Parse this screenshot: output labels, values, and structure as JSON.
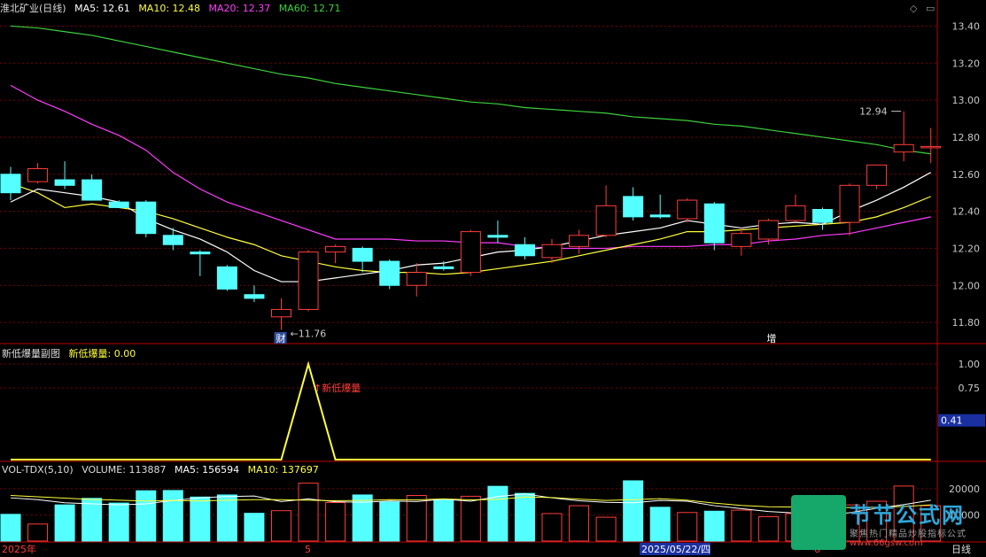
{
  "header": {
    "title": "淮北矿业(日线)",
    "ma5": "MA5: 12.61",
    "ma10": "MA10: 12.48",
    "ma20": "MA20: 12.37",
    "ma60": "MA60: 12.71"
  },
  "colors": {
    "up": "#ff3c3c",
    "down": "#54ffff",
    "ma5": "#ffffff",
    "ma10": "#ffff3c",
    "ma20": "#ff3cff",
    "ma60": "#3cd23c",
    "grid": "#7a0000",
    "axis": "#c00000"
  },
  "price_axis": {
    "ticks": [
      "13.40",
      "13.20",
      "13.00",
      "12.80",
      "12.60",
      "12.40",
      "12.20",
      "12.00",
      "11.80"
    ]
  },
  "annotations": {
    "high_label": "12.94",
    "low_label": "11.76",
    "cai_tag": "财",
    "zeng_tag": "增"
  },
  "indicator": {
    "title": "新低爆量副图",
    "value_label": "新低爆量: 0.00",
    "signal_label": "新低爆量",
    "ticks": [
      "1.00",
      "0.75",
      "0.41"
    ],
    "current": "0.41",
    "values": [
      0,
      0,
      0,
      0,
      0,
      0,
      0,
      0,
      0,
      0,
      0,
      1,
      0,
      0,
      0,
      0,
      0,
      0,
      0,
      0,
      0,
      0,
      0,
      0,
      0,
      0,
      0,
      0,
      0,
      0,
      0,
      0,
      0,
      0,
      0
    ]
  },
  "volume": {
    "title": "VOL-TDX(5,10)",
    "volume": "VOLUME: 113887",
    "ma5": "MA5: 156594",
    "ma10": "MA10: 137697",
    "ticks": [
      "20000",
      "10000"
    ],
    "x_labels": [
      "2025年",
      "5",
      "2025/05/22/四",
      "6",
      "日线"
    ]
  },
  "watermark": {
    "brand": "节节公式网",
    "slogan": "聚焦热门精品炒股指标公式",
    "url": "www.66gsw.com"
  },
  "chart_data": {
    "type": "candlestick",
    "ylim": [
      11.7,
      13.45
    ],
    "candles": [
      {
        "o": 12.6,
        "c": 12.5,
        "h": 12.64,
        "l": 12.46
      },
      {
        "o": 12.56,
        "c": 12.63,
        "h": 12.66,
        "l": 12.55
      },
      {
        "o": 12.57,
        "c": 12.54,
        "h": 12.67,
        "l": 12.52
      },
      {
        "o": 12.57,
        "c": 12.46,
        "h": 12.6,
        "l": 12.46
      },
      {
        "o": 12.45,
        "c": 12.42,
        "h": 12.46,
        "l": 12.42
      },
      {
        "o": 12.45,
        "c": 12.28,
        "h": 12.46,
        "l": 12.26
      },
      {
        "o": 12.27,
        "c": 12.22,
        "h": 12.31,
        "l": 12.19
      },
      {
        "o": 12.18,
        "c": 12.17,
        "h": 12.19,
        "l": 12.05
      },
      {
        "o": 12.1,
        "c": 11.98,
        "h": 12.11,
        "l": 11.97
      },
      {
        "o": 11.95,
        "c": 11.93,
        "h": 12.0,
        "l": 11.91
      },
      {
        "o": 11.83,
        "c": 11.87,
        "h": 11.93,
        "l": 11.76
      },
      {
        "o": 11.87,
        "c": 12.18,
        "h": 12.19,
        "l": 11.86
      },
      {
        "o": 12.18,
        "c": 12.21,
        "h": 12.22,
        "l": 12.12
      },
      {
        "o": 12.2,
        "c": 12.13,
        "h": 12.21,
        "l": 12.07
      },
      {
        "o": 12.13,
        "c": 12.0,
        "h": 12.14,
        "l": 11.98
      },
      {
        "o": 12.0,
        "c": 12.07,
        "h": 12.12,
        "l": 11.94
      },
      {
        "o": 12.1,
        "c": 12.09,
        "h": 12.13,
        "l": 12.08
      },
      {
        "o": 12.07,
        "c": 12.29,
        "h": 12.3,
        "l": 12.05
      },
      {
        "o": 12.27,
        "c": 12.26,
        "h": 12.35,
        "l": 12.23
      },
      {
        "o": 12.22,
        "c": 12.16,
        "h": 12.26,
        "l": 12.14
      },
      {
        "o": 12.15,
        "c": 12.22,
        "h": 12.25,
        "l": 12.12
      },
      {
        "o": 12.21,
        "c": 12.27,
        "h": 12.3,
        "l": 12.17
      },
      {
        "o": 12.27,
        "c": 12.43,
        "h": 12.54,
        "l": 12.26
      },
      {
        "o": 12.48,
        "c": 12.37,
        "h": 12.53,
        "l": 12.35
      },
      {
        "o": 12.38,
        "c": 12.37,
        "h": 12.49,
        "l": 12.36
      },
      {
        "o": 12.36,
        "c": 12.46,
        "h": 12.47,
        "l": 12.34
      },
      {
        "o": 12.44,
        "c": 12.23,
        "h": 12.45,
        "l": 12.19
      },
      {
        "o": 12.21,
        "c": 12.28,
        "h": 12.31,
        "l": 12.16
      },
      {
        "o": 12.25,
        "c": 12.35,
        "h": 12.36,
        "l": 12.22
      },
      {
        "o": 12.35,
        "c": 12.43,
        "h": 12.49,
        "l": 12.34
      },
      {
        "o": 12.41,
        "c": 12.34,
        "h": 12.42,
        "l": 12.3
      },
      {
        "o": 12.34,
        "c": 12.54,
        "h": 12.55,
        "l": 12.27
      },
      {
        "o": 12.54,
        "c": 12.65,
        "h": 12.65,
        "l": 12.52
      },
      {
        "o": 12.72,
        "c": 12.76,
        "h": 12.94,
        "l": 12.67
      },
      {
        "o": 12.75,
        "c": 12.75,
        "h": 12.85,
        "l": 12.66
      }
    ],
    "ma5": [
      12.45,
      12.52,
      12.5,
      12.48,
      12.45,
      12.36,
      12.3,
      12.25,
      12.18,
      12.08,
      12.02,
      12.02,
      12.04,
      12.06,
      12.08,
      12.11,
      12.12,
      12.15,
      12.18,
      12.19,
      12.21,
      12.24,
      12.27,
      12.29,
      12.31,
      12.35,
      12.33,
      12.31,
      12.33,
      12.34,
      12.33,
      12.4,
      12.46,
      12.53,
      12.61
    ],
    "ma10": [
      12.55,
      12.5,
      12.42,
      12.44,
      12.42,
      12.4,
      12.36,
      12.31,
      12.26,
      12.22,
      12.16,
      12.13,
      12.1,
      12.08,
      12.07,
      12.07,
      12.06,
      12.07,
      12.09,
      12.11,
      12.13,
      12.16,
      12.19,
      12.22,
      12.25,
      12.29,
      12.29,
      12.3,
      12.31,
      12.32,
      12.33,
      12.34,
      12.37,
      12.42,
      12.48
    ],
    "ma20": [
      13.08,
      13.0,
      12.94,
      12.87,
      12.81,
      12.73,
      12.61,
      12.52,
      12.45,
      12.4,
      12.35,
      12.3,
      12.25,
      12.25,
      12.25,
      12.24,
      12.24,
      12.23,
      12.23,
      12.21,
      12.2,
      12.2,
      12.2,
      12.21,
      12.21,
      12.21,
      12.22,
      12.22,
      12.24,
      12.25,
      12.27,
      12.28,
      12.31,
      12.34,
      12.37
    ],
    "ma60": [
      13.4,
      13.39,
      13.37,
      13.35,
      13.32,
      13.29,
      13.26,
      13.23,
      13.2,
      13.17,
      13.14,
      13.12,
      13.09,
      13.07,
      13.05,
      13.03,
      13.01,
      12.99,
      12.98,
      12.96,
      12.95,
      12.94,
      12.93,
      12.91,
      12.9,
      12.89,
      12.87,
      12.86,
      12.84,
      12.82,
      12.8,
      12.78,
      12.76,
      12.73,
      12.71
    ],
    "volume": [
      10200,
      6500,
      13800,
      16300,
      14500,
      19200,
      19300,
      16800,
      17600,
      10600,
      11600,
      22100,
      14700,
      17600,
      14900,
      17400,
      15800,
      17100,
      20900,
      18200,
      10500,
      13500,
      9100,
      23000,
      12900,
      10900,
      11400,
      11800,
      9300,
      10500,
      9000,
      13800,
      15200,
      21000,
      13500
    ],
    "vol_ma5": [
      16500,
      15800,
      14600,
      14200,
      13800,
      14200,
      15500,
      16500,
      17000,
      17200,
      15100,
      16100,
      15000,
      14800,
      15300,
      15100,
      16000,
      15200,
      17000,
      18000,
      16500,
      15400,
      14800,
      14600,
      15500,
      15200,
      13500,
      12400,
      11300,
      10700,
      9900,
      10800,
      12500,
      13900,
      15600
    ],
    "vol_ma10": [
      17400,
      16900,
      16400,
      15900,
      15600,
      15300,
      15500,
      15300,
      15600,
      15800,
      15800,
      15600,
      15400,
      15500,
      15800,
      15700,
      16100,
      15700,
      15900,
      16800,
      16600,
      16000,
      15500,
      15800,
      16200,
      15600,
      14500,
      13600,
      13100,
      13000,
      12700,
      12800,
      12900,
      13200,
      13800
    ]
  }
}
